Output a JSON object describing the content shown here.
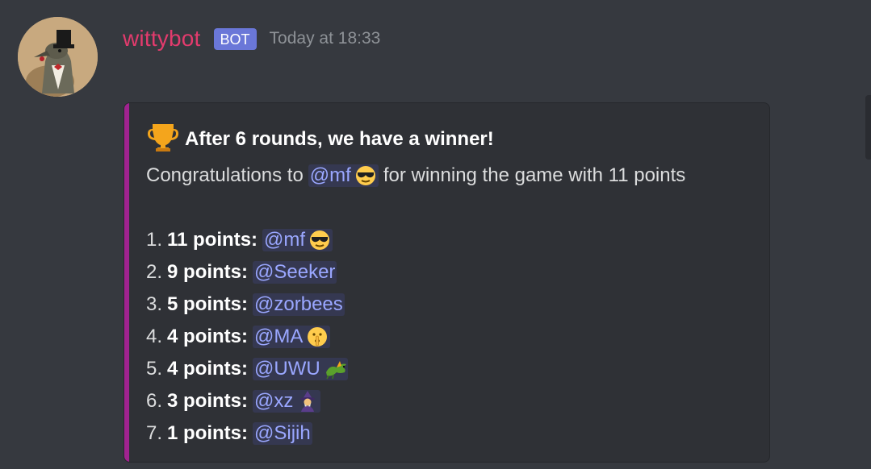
{
  "message": {
    "username": "wittybot",
    "bot_tag": "BOT",
    "timestamp": "Today at 18:33"
  },
  "embed": {
    "accent_color": "#a0238f",
    "title": "After 6 rounds, we have a winner!",
    "title_icon": "trophy-icon",
    "description": {
      "prefix": "Congratulations to",
      "mention": "@mf",
      "mention_emoji": "sunglasses-emoji",
      "suffix": "for winning the game with 11 points"
    },
    "ranks": [
      {
        "num": "1.",
        "points": "11 points:",
        "mention": "@mf",
        "emoji": "sunglasses-emoji"
      },
      {
        "num": "2.",
        "points": "9 points:",
        "mention": "@Seeker",
        "emoji": ""
      },
      {
        "num": "3.",
        "points": "5 points:",
        "mention": "@zorbees",
        "emoji": ""
      },
      {
        "num": "4.",
        "points": "4 points:",
        "mention": "@MA",
        "emoji": "shushing-face-emoji"
      },
      {
        "num": "5.",
        "points": "4 points:",
        "mention": "@UWU",
        "emoji": "dragon-emoji"
      },
      {
        "num": "6.",
        "points": "3 points:",
        "mention": "@xz",
        "emoji": "mage-emoji"
      },
      {
        "num": "7.",
        "points": "1 points:",
        "mention": "@Sijih",
        "emoji": ""
      }
    ]
  },
  "colors": {
    "background": "#36393f",
    "embed_background": "#2f3136",
    "username": "#e23b6d",
    "bot_tag": "#6a77d8",
    "mention_text": "#9aa7ff"
  }
}
